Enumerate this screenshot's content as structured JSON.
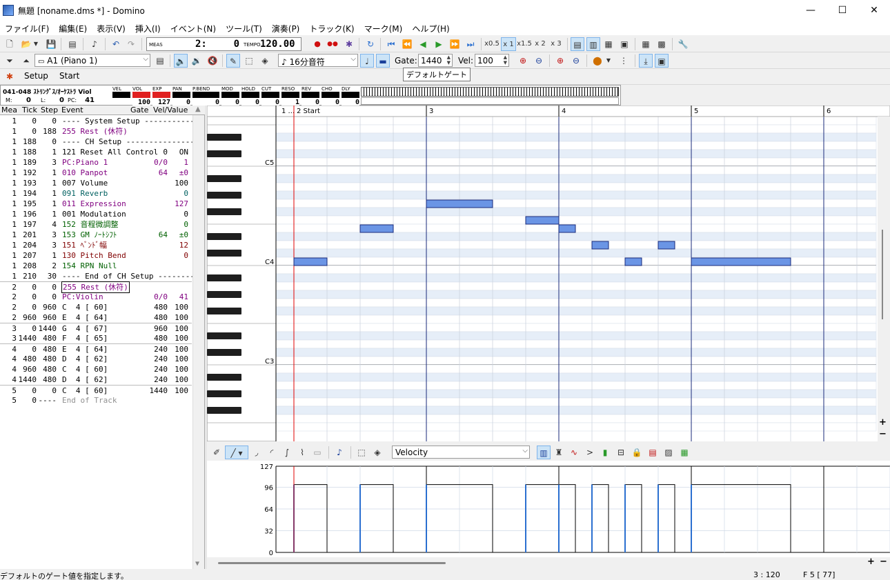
{
  "window": {
    "title": "無題 [noname.dms *] - Domino",
    "minimize": "—",
    "maximize": "☐",
    "close": "✕"
  },
  "menu": [
    "ファイル(F)",
    "編集(E)",
    "表示(V)",
    "挿入(I)",
    "イベント(N)",
    "ツール(T)",
    "演奏(P)",
    "トラック(K)",
    "マーク(M)",
    "ヘルプ(H)"
  ],
  "transport": {
    "meas_label": "MEAS",
    "position_measure": "2:",
    "position_tick": "0",
    "tempo_label": "TEMPO",
    "tempo": "120.00",
    "speed_options": [
      "x0.5",
      "x 1",
      "x1.5",
      "x 2",
      "x 3"
    ]
  },
  "edit_toolbar": {
    "track_select": "A1 (Piano 1)",
    "note_length": "16分音符",
    "gate_label": "Gate:",
    "gate_value": "1440",
    "vel_label": "Vel:",
    "vel_value": "100"
  },
  "tabs": [
    "Setup",
    "Start"
  ],
  "tooltip": "デフォルトゲート",
  "track_monitor": {
    "instrument": "041-048 ｽﾄﾘﾝｸﾞｽ/ｵｰｹｽﾄﾗ Viol",
    "m_label": "M:",
    "m_value": "0",
    "l_label": "L:",
    "l_value": "0",
    "pc_label": "PC:",
    "pc_value": "41",
    "headers": [
      "VEL",
      "VOL",
      "EXP",
      "PAN",
      "P.BEND",
      "MOD",
      "HOLD",
      "CUT",
      "RESO",
      "REV",
      "CHO",
      "DLY"
    ],
    "values": [
      "",
      "100",
      "127",
      "0",
      "0",
      "0",
      "0",
      "0",
      "1",
      "0",
      "0",
      "0"
    ]
  },
  "event_list": {
    "columns": [
      "Mea",
      "Tick",
      "Step",
      "Event",
      "Gate",
      "Vel/Value"
    ],
    "rows": [
      {
        "mea": "1",
        "tick": "0",
        "step": "0",
        "event": "---- System Setup -------------",
        "gate": "",
        "value": "",
        "color": "#000000"
      },
      {
        "mea": "1",
        "tick": "0",
        "step": "188",
        "event": "255 Rest (休符)",
        "gate": "",
        "value": "",
        "color": "#800080"
      },
      {
        "mea": "1",
        "tick": "188",
        "step": "0",
        "event": "---- CH Setup -----------------",
        "gate": "",
        "value": "",
        "color": "#000000"
      },
      {
        "mea": "1",
        "tick": "188",
        "step": "1",
        "event": "121 Reset All Control",
        "gate": "0",
        "value": "ON",
        "color": "#000000"
      },
      {
        "mea": "1",
        "tick": "189",
        "step": "3",
        "event": "PC:Piano 1",
        "gate": "0/0",
        "value": "1",
        "color": "#800080"
      },
      {
        "mea": "1",
        "tick": "192",
        "step": "1",
        "event": "010 Panpot",
        "gate": "64",
        "value": "±0",
        "color": "#800080"
      },
      {
        "mea": "1",
        "tick": "193",
        "step": "1",
        "event": "007 Volume",
        "gate": "",
        "value": "100",
        "color": "#000000"
      },
      {
        "mea": "1",
        "tick": "194",
        "step": "1",
        "event": "091 Reverb",
        "gate": "",
        "value": "0",
        "color": "#006060"
      },
      {
        "mea": "1",
        "tick": "195",
        "step": "1",
        "event": "011 Expression",
        "gate": "",
        "value": "127",
        "color": "#800080"
      },
      {
        "mea": "1",
        "tick": "196",
        "step": "1",
        "event": "001 Modulation",
        "gate": "",
        "value": "0",
        "color": "#000000"
      },
      {
        "mea": "1",
        "tick": "197",
        "step": "4",
        "event": "152 音程微調整",
        "gate": "",
        "value": "0",
        "color": "#006000"
      },
      {
        "mea": "1",
        "tick": "201",
        "step": "3",
        "event": "153 GM ﾉｰﾄｼﾌﾄ",
        "gate": "64",
        "value": "±0",
        "color": "#006000"
      },
      {
        "mea": "1",
        "tick": "204",
        "step": "3",
        "event": "151 ﾍﾞﾝﾄﾞ幅",
        "gate": "",
        "value": "12",
        "color": "#800000"
      },
      {
        "mea": "1",
        "tick": "207",
        "step": "1",
        "event": "130 Pitch Bend",
        "gate": "",
        "value": "0",
        "color": "#800000"
      },
      {
        "mea": "1",
        "tick": "208",
        "step": "2",
        "event": "154 RPN Null",
        "gate": "",
        "value": "",
        "color": "#006000"
      },
      {
        "mea": "1",
        "tick": "210",
        "step": "30",
        "event": "---- End of CH Setup ----------",
        "gate": "",
        "value": "",
        "color": "#000000"
      },
      {
        "mea": "2",
        "tick": "0",
        "step": "0",
        "event": "255 Rest (休符)",
        "gate": "",
        "value": "",
        "color": "#800080"
      },
      {
        "mea": "2",
        "tick": "0",
        "step": "0",
        "event": "PC:Violin",
        "gate": "0/0",
        "value": "41",
        "color": "#800080"
      },
      {
        "mea": "2",
        "tick": "0",
        "step": "960",
        "event": "C  4 [ 60]",
        "gate": "480",
        "value": "100",
        "color": "#000000"
      },
      {
        "mea": "2",
        "tick": "960",
        "step": "960",
        "event": "E  4 [ 64]",
        "gate": "480",
        "value": "100",
        "color": "#000000"
      },
      {
        "mea": "3",
        "tick": "0",
        "step": "1440",
        "event": "G  4 [ 67]",
        "gate": "960",
        "value": "100",
        "color": "#000000"
      },
      {
        "mea": "3",
        "tick": "1440",
        "step": "480",
        "event": "F  4 [ 65]",
        "gate": "480",
        "value": "100",
        "color": "#000000"
      },
      {
        "mea": "4",
        "tick": "0",
        "step": "480",
        "event": "E  4 [ 64]",
        "gate": "240",
        "value": "100",
        "color": "#000000"
      },
      {
        "mea": "4",
        "tick": "480",
        "step": "480",
        "event": "D  4 [ 62]",
        "gate": "240",
        "value": "100",
        "color": "#000000"
      },
      {
        "mea": "4",
        "tick": "960",
        "step": "480",
        "event": "C  4 [ 60]",
        "gate": "240",
        "value": "100",
        "color": "#000000"
      },
      {
        "mea": "4",
        "tick": "1440",
        "step": "480",
        "event": "D  4 [ 62]",
        "gate": "240",
        "value": "100",
        "color": "#000000"
      },
      {
        "mea": "5",
        "tick": "0",
        "step": "0",
        "event": "C  4 [ 60]",
        "gate": "1440",
        "value": "100",
        "color": "#000000"
      },
      {
        "mea": "5",
        "tick": "0",
        "step": "----",
        "event": "End of Track",
        "gate": "",
        "value": "",
        "color": "#909090"
      }
    ]
  },
  "piano_roll": {
    "measure_labels": [
      "1 ...",
      "2 Start",
      "3",
      "4",
      "5",
      "6"
    ],
    "octave_labels": [
      "C5",
      "C4",
      "C3"
    ],
    "zoom_in": "+",
    "zoom_out": "−",
    "notes": [
      {
        "pitch": "C4",
        "midi": 60,
        "measure": 2,
        "tick": 0,
        "gate": 480,
        "velocity": 100
      },
      {
        "pitch": "E4",
        "midi": 64,
        "measure": 2,
        "tick": 960,
        "gate": 480,
        "velocity": 100
      },
      {
        "pitch": "G4",
        "midi": 67,
        "measure": 3,
        "tick": 0,
        "gate": 960,
        "velocity": 100
      },
      {
        "pitch": "F4",
        "midi": 65,
        "measure": 3,
        "tick": 1440,
        "gate": 480,
        "velocity": 100
      },
      {
        "pitch": "E4",
        "midi": 64,
        "measure": 4,
        "tick": 0,
        "gate": 240,
        "velocity": 100
      },
      {
        "pitch": "D4",
        "midi": 62,
        "measure": 4,
        "tick": 480,
        "gate": 240,
        "velocity": 100
      },
      {
        "pitch": "C4",
        "midi": 60,
        "measure": 4,
        "tick": 960,
        "gate": 240,
        "velocity": 100
      },
      {
        "pitch": "D4",
        "midi": 62,
        "measure": 4,
        "tick": 1440,
        "gate": 240,
        "velocity": 100
      },
      {
        "pitch": "C4",
        "midi": 60,
        "measure": 5,
        "tick": 0,
        "gate": 1440,
        "velocity": 100
      }
    ]
  },
  "controller": {
    "type": "Velocity",
    "scale_labels": [
      "127",
      "96",
      "64",
      "32",
      "0"
    ]
  },
  "status": {
    "message": "デフォルトのゲート値を指定します。",
    "position": "3 : 120",
    "pitch": "F 5 [ 77]"
  },
  "colors": {
    "note_fill": "#6b95e5",
    "playhead": "#e00000",
    "measure_line": "#1a2a7a",
    "accent": "#cce4f7"
  }
}
